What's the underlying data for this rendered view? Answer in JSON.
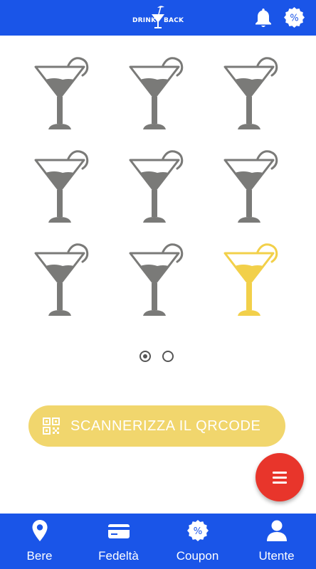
{
  "header": {
    "logo_left": "DRINK",
    "logo_right": "BACK",
    "bell_icon": "bell-icon",
    "discount_icon": "percent-badge-icon"
  },
  "colors": {
    "brand_blue": "#1a55e8",
    "glass_inactive": "#7a7a78",
    "glass_active": "#f2d04a",
    "scan_button": "#f1d66d",
    "fab": "#e8352b"
  },
  "loyalty": {
    "glasses_total": 9,
    "glasses_highlighted_index": 8,
    "glass_icon": "martini-glass-icon"
  },
  "pager": {
    "pages": 2,
    "current": 1
  },
  "scan_button": {
    "label": "SCANNERIZZA IL QRCODE",
    "icon": "qr-code-icon"
  },
  "fab": {
    "icon": "menu-icon"
  },
  "bottom_nav": {
    "items": [
      {
        "label": "Bere",
        "icon": "location-pin-icon"
      },
      {
        "label": "Fedeltà",
        "icon": "credit-card-icon"
      },
      {
        "label": "Coupon",
        "icon": "percent-badge-icon"
      },
      {
        "label": "Utente",
        "icon": "user-icon"
      }
    ]
  }
}
